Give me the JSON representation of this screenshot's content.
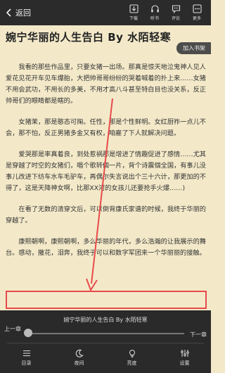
{
  "header": {
    "back_label": "返回",
    "actions": [
      {
        "label": "下载",
        "icon": "download-icon"
      },
      {
        "label": "听书",
        "icon": "headphones-icon"
      },
      {
        "label": "评论",
        "icon": "comment-icon"
      },
      {
        "label": "更多",
        "icon": "more-icon"
      }
    ]
  },
  "book": {
    "title": "婉宁华丽的人生告白 By 水陌轻寒",
    "add_shelf_label": "加入书架"
  },
  "content": {
    "paragraphs": [
      "我看的那些作品里，只要女猪一出场。那真是惊天地泣鬼神人见人爱花见花开车见车爆胎，大把帅哥哥纷纷的哭着喊着的扑上来……女猪不用会武功，不用长的多美，不用才高八斗甚至特白目也没关系，反正帅哥们的眼睛都是瞎的。",
      "女猪茉，那是憨态可掬。任性，那是个性鲜明。女红厨祚一点儿不会，那不怕，反正男猪多金又有权，咱雇了下人就解决问题。",
      "爱哭那是率真着良，到处惹祸那是增进了情趣促进了感情……尤其是穿越了时空的女猪们，唱个歌转個一片，背个诗震個全国，有事儿没事儿改进下纺车水车毛驴车，再偶尔失言说出个三十六计，那更加的不得了，这是天降神女啊，比那XX河的女孩儿还要抢手火爆……)",
      "在看了无数的清穿文后，可以倒背康氏家谱的时候，我终于华丽的穿越了。",
      "康熙朝啊，康熙朝啊，多么华丽的年代，多么浩瀚的让我展示的舞台。感动，撒花，泪奔，我终于可以和数字军团来一个华丽丽的接触。"
    ]
  },
  "reader_panel": {
    "chapter_title": "婉宁华丽的人生告白 By 水陌轻寒",
    "prev_chapter": "上一章",
    "next_chapter": "下一章",
    "progress_fraction": 0.0,
    "nav": [
      {
        "label": "目录",
        "icon": "catalog-icon"
      },
      {
        "label": "夜间",
        "icon": "night-mode-icon"
      },
      {
        "label": "亮度",
        "icon": "brightness-icon"
      },
      {
        "label": "设置",
        "icon": "settings-icon"
      }
    ]
  },
  "colors": {
    "paper": "#f3e9c9",
    "toolbar": "#2b2b2b",
    "annotation": "#e84a4a"
  }
}
